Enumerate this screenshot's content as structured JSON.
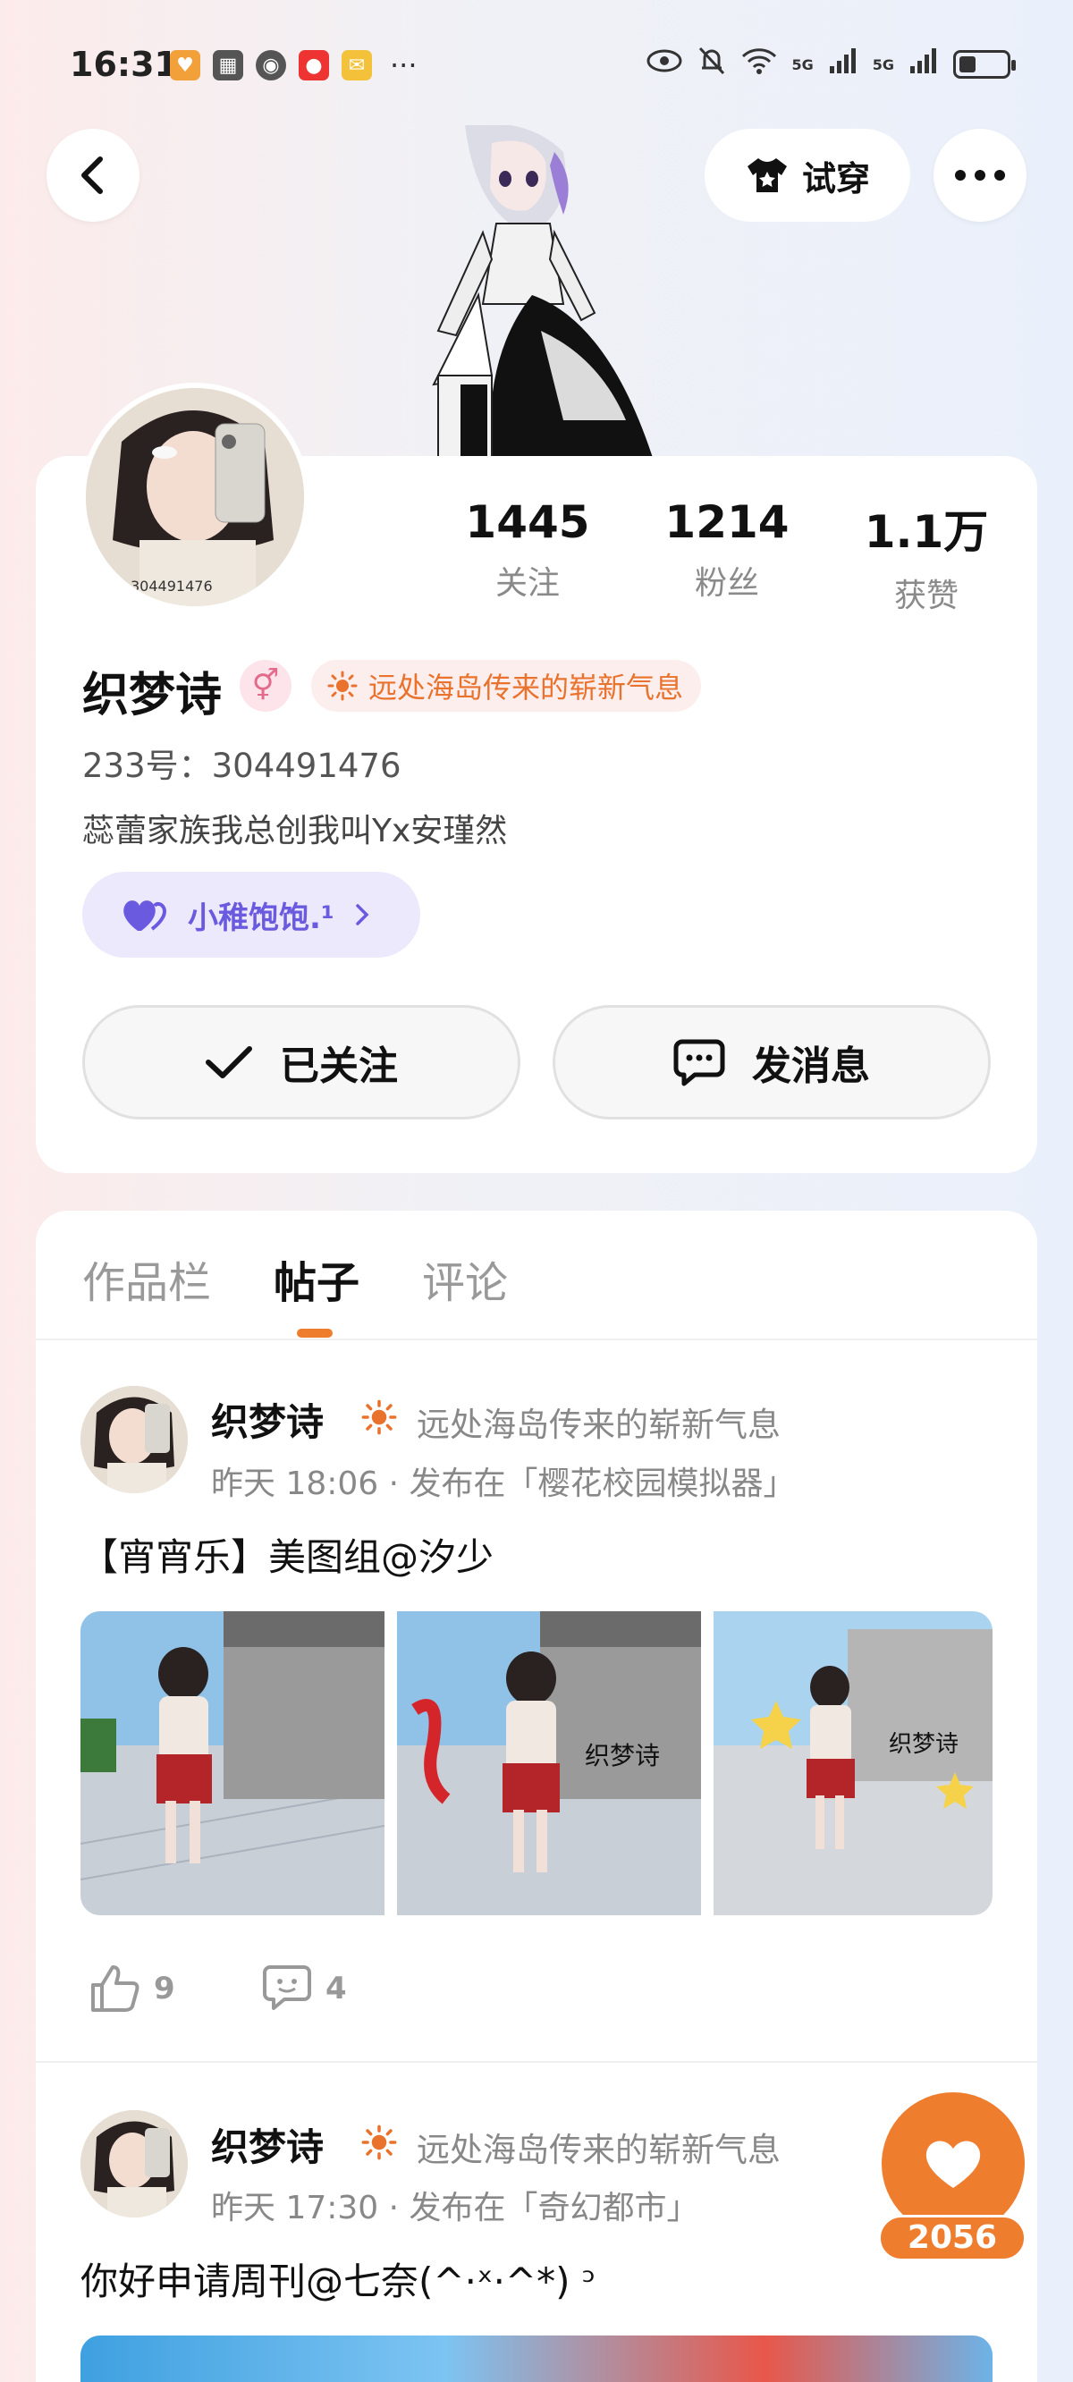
{
  "status_bar": {
    "time": "16:31",
    "more": "···",
    "net1": "5G",
    "net2": "5G"
  },
  "header": {
    "try_label": "试穿"
  },
  "profile": {
    "avatar_id_text": "304491476",
    "stats": [
      {
        "num": "1445",
        "label": "关注"
      },
      {
        "num": "1214",
        "label": "粉丝"
      },
      {
        "num": "1.1万",
        "label": "获赞"
      }
    ],
    "name": "织梦诗",
    "gender_symbol": "⚥",
    "tag": "远处海岛传来的崭新气息",
    "uid": "233号：304491476",
    "bio": "蕊蕾家族我总创我叫Yx安瑾然",
    "club": "小稚饱饱.¹",
    "follow_label": "已关注",
    "message_label": "发消息"
  },
  "tabs": [
    "作品栏",
    "帖子",
    "评论"
  ],
  "posts": [
    {
      "name": "织梦诗",
      "tag": "远处海岛传来的崭新气息",
      "meta": "昨天 18:06 · 发布在「樱花校园模拟器」",
      "text": "【宵宵乐】美图组@汐少",
      "watermark": "织梦诗",
      "likes": "9",
      "comments": "4"
    },
    {
      "name": "织梦诗",
      "tag": "远处海岛传来的崭新气息",
      "meta": "昨天 17:30 · 发布在「奇幻都市」",
      "text": "你好申请周刊@七奈(^·ˣ·^*) ᵓ"
    }
  ],
  "fab": {
    "count": "2056"
  },
  "colors": {
    "accent": "#ef7d2e",
    "club": "#6a5ae0"
  }
}
